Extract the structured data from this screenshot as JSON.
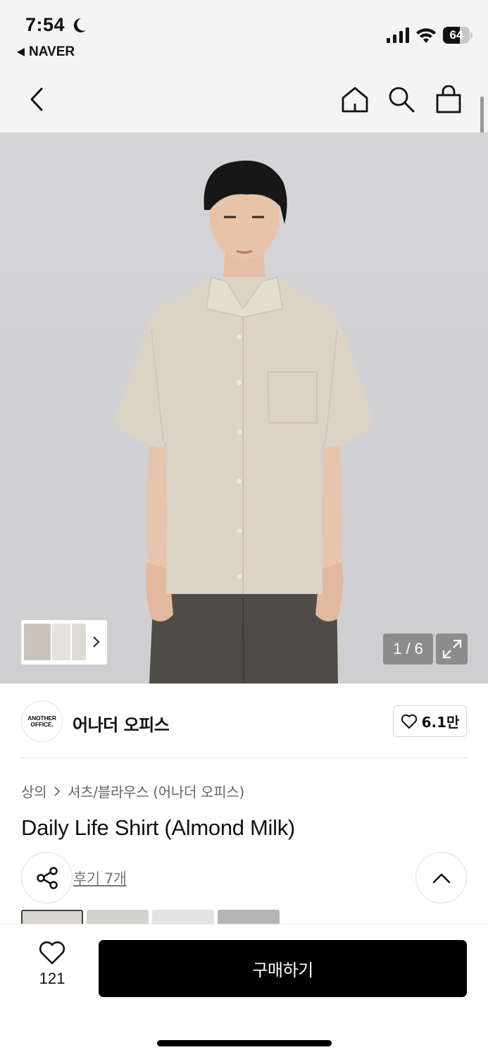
{
  "status_bar": {
    "time": "7:54",
    "back_app": "NAVER",
    "battery_level": 64,
    "battery_text": "64"
  },
  "nav": {
    "icons": [
      "back-chevron-icon",
      "home-icon",
      "search-icon",
      "shopping-bag-icon"
    ]
  },
  "gallery": {
    "counter_current": "1",
    "counter_sep": "/",
    "counter_total": "6"
  },
  "brand": {
    "logo_line1": "ANOTHER",
    "logo_line2": "OFFICE.",
    "name": "어나더 오피스",
    "likes": "6.1만"
  },
  "breadcrumb": {
    "category": "상의",
    "subcategory": "셔츠/블라우스 (어나더 오피스)"
  },
  "product": {
    "title": "Daily Life Shirt (Almond Milk)",
    "reviews": "후기 7개"
  },
  "swatch_colors": [
    "#d9d6d0",
    "#d4d2cf",
    "#e2e2e2",
    "#b5b5b5"
  ],
  "bottom_bar": {
    "wish_count": "121",
    "buy_label": "구매하기"
  },
  "colors": {
    "accent": "#000000",
    "background": "#f4f4f4",
    "shirt": "#dcd3c6"
  }
}
